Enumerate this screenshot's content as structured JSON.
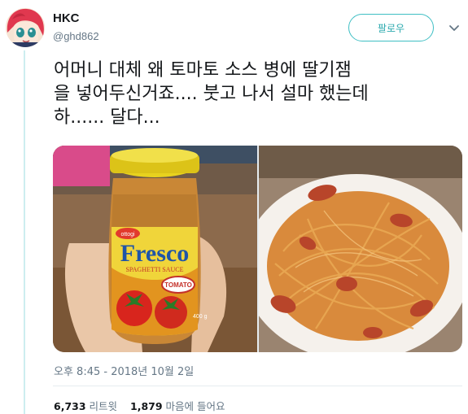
{
  "user": {
    "name": "HKC",
    "handle": "@ghd862"
  },
  "follow_button": {
    "label": "팔로우"
  },
  "tweet": {
    "text_lines": [
      "어머니 대체 왜 토마토 소스 병에 딸기잼",
      "을 넣어두신거죠.... 붓고 나서 설마 했는데",
      "하...... 달다..."
    ],
    "timestamp": "오후 8:45 - 2018년 10월 2일"
  },
  "photo1": {
    "brand": "Fresco",
    "subtitle": "SPAGHETTI SAUCE",
    "badge": "TOMATO",
    "maker": "ottogi",
    "weight": "400 g"
  },
  "stats": {
    "retweets_count": "6,733",
    "retweets_label": "리트윗",
    "likes_count": "1,879",
    "likes_label": "마음에 들어요"
  },
  "colors": {
    "accent": "#2ba9ae",
    "thread_line": "#cdeef0",
    "muted_text": "#657786"
  },
  "icons": {
    "caret": "chevron-down-icon"
  }
}
